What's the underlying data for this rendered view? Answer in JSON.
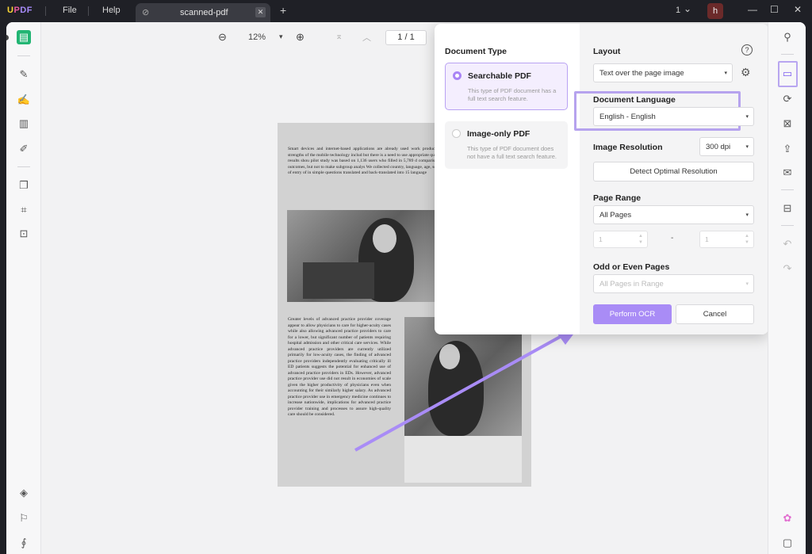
{
  "app": {
    "logo_1": "U",
    "logo_2": "P",
    "logo_3": "DF"
  },
  "menu": {
    "file": "File",
    "help": "Help"
  },
  "tab": {
    "title": "scanned-pdf",
    "close": "✕"
  },
  "titlebar": {
    "plus": "+",
    "count": "1",
    "chevron": "⌄",
    "avatar": "h",
    "minimize": "—",
    "maximize": "☐",
    "close": "✕"
  },
  "toolbar": {
    "zoom_out": "⊖",
    "zoom": "12%",
    "zoom_caret": "▾",
    "zoom_in": "⊕",
    "first_page": "⌅",
    "prev_page": "︿",
    "page": "1 / 1"
  },
  "pdf": {
    "para1": "Smart devices and internet-based applications are already used work productivity. The strengths of the mobile technology includ but there is a need to use appropriate questions and results shou pilot study was based on 1,136 users who filled in 5,789 d comparisons among outcomes, but not to make subgroup analys We collected country, language, age, sex and date of entry of in simple questions translated and back-translated into 15 language",
    "para2": "Greater levels of advanced practice provider coverage appear to allow physicians to care for higher-acuity cases while also allowing advanced practice providers to care for a lower, but significant number of patients requiring hospital admission and other critical care services. While advanced practice providers are currently utilized primarily for low-acuity cases, the finding of advanced practice providers independently evaluating critically ill ED patients suggests the potential for enhanced use of advanced practice providers in EDs. However, advanced practice provider use did not result in economies of scale given the higher productivity of physicians even when accounting for their similarly higher salary. As advanced practice provider use in emergency medicine continues to increase nationwide, implications for advanced practice provider training and processes to assure high-quality care should be considered."
  },
  "ocr": {
    "doc_type_title": "Document Type",
    "searchable_title": "Searchable PDF",
    "searchable_desc": "This type of PDF document has a full text search feature.",
    "image_only_title": "Image-only PDF",
    "image_only_desc": "This type of PDF document does not have a full text search feature.",
    "layout_label": "Layout",
    "help": "?",
    "layout_value": "Text over the page image",
    "gear": "⚙",
    "language_label": "Document Language",
    "language_value": "English - English",
    "resolution_label": "Image Resolution",
    "resolution_value": "300 dpi",
    "detect_btn": "Detect Optimal Resolution",
    "range_label": "Page Range",
    "range_value": "All Pages",
    "range_from": "1",
    "range_dash": "-",
    "range_to": "1",
    "odd_even_label": "Odd or Even Pages",
    "odd_even_value": "All Pages in Range",
    "perform_btn": "Perform OCR",
    "cancel_btn": "Cancel",
    "caret": "▾",
    "spin_arrows": "▲▼"
  },
  "icons": {
    "reader": "▤",
    "highlight": "✎",
    "edit": "✍",
    "organize": "▥",
    "form": "✐",
    "pages": "❐",
    "crop": "⌗",
    "protect": "⊡",
    "layers": "◈",
    "bookmark": "⚐",
    "attach": "∮",
    "search": "⚲",
    "ocr": "▭",
    "convert": "⟳",
    "secure": "⊠",
    "share": "⇪",
    "mail": "✉",
    "save": "⊟",
    "undo": "↶",
    "redo": "↷",
    "ai": "✿",
    "comment": "▢"
  },
  "colors": {
    "accent_purple": "#a98cf6",
    "highlight": "#b6a3ee",
    "green_active": "#22b573"
  }
}
